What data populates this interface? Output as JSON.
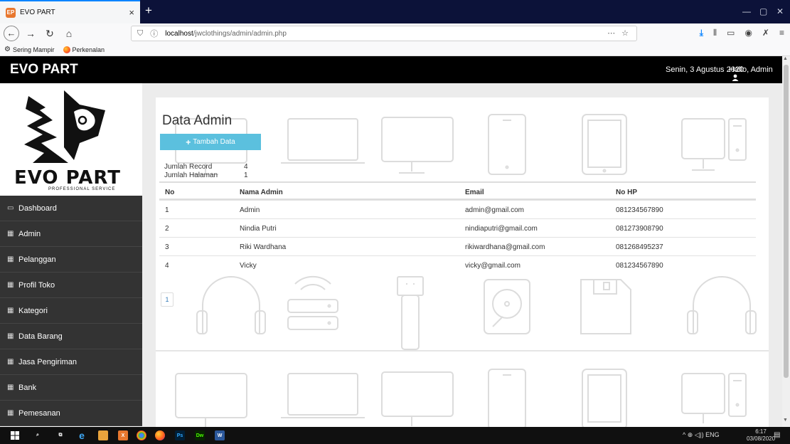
{
  "browser": {
    "tab_title": "EVO PART",
    "tab_favicon": "EP",
    "tab_close": "×",
    "new_tab": "+",
    "url_host": "localhost",
    "url_path": "/jwclothings/admin/admin.php",
    "url_actions": "⋯ ☆",
    "bookmarks": [
      "Sering Mampir",
      "Perkenalan"
    ],
    "window_controls": [
      "—",
      "▢",
      "✕"
    ]
  },
  "header": {
    "brand": "EVO PART",
    "date": "Senin, 3 Agustus 2020",
    "greeting": "Hallo, Admin"
  },
  "logo": {
    "text": "EVO PART",
    "subtitle": "PROFESSIONAL SERVICE"
  },
  "menu": [
    {
      "label": "Dashboard",
      "icon": "monitor-icon"
    },
    {
      "label": "Admin",
      "icon": "table-icon"
    },
    {
      "label": "Pelanggan",
      "icon": "table-icon"
    },
    {
      "label": "Profil Toko",
      "icon": "table-icon"
    },
    {
      "label": "Kategori",
      "icon": "table-icon"
    },
    {
      "label": "Data Barang",
      "icon": "table-icon"
    },
    {
      "label": "Jasa Pengiriman",
      "icon": "table-icon"
    },
    {
      "label": "Bank",
      "icon": "table-icon"
    },
    {
      "label": "Pemesanan",
      "icon": "table-icon"
    }
  ],
  "content": {
    "title": "Data Admin",
    "add_button": "Tambah Data",
    "stats": {
      "record_label": "Jumlah Record",
      "record_value": "4",
      "pages_label": "Jumlah Halaman",
      "pages_value": "1"
    },
    "table": {
      "headers": [
        "No",
        "Nama Admin",
        "Email",
        "No HP"
      ],
      "rows": [
        [
          "1",
          "Admin",
          "admin@gmail.com",
          "081234567890"
        ],
        [
          "2",
          "Nindia Putri",
          "nindiaputri@gmail.com",
          "081273908790"
        ],
        [
          "3",
          "Riki Wardhana",
          "rikiwardhana@gmail.com",
          "081268495237"
        ],
        [
          "4",
          "Vicky",
          "vicky@gmail.com",
          "081234567890"
        ]
      ]
    },
    "pagination": [
      "1"
    ]
  },
  "taskbar": {
    "tray": "^ ⊕ ◁)) ENG",
    "time": "6:17",
    "date": "03/08/2020"
  },
  "colors": {
    "topbar": "#000000",
    "sidebar_item": "#333333",
    "add_button": "#5bc0de",
    "page_bg": "#ececec"
  }
}
